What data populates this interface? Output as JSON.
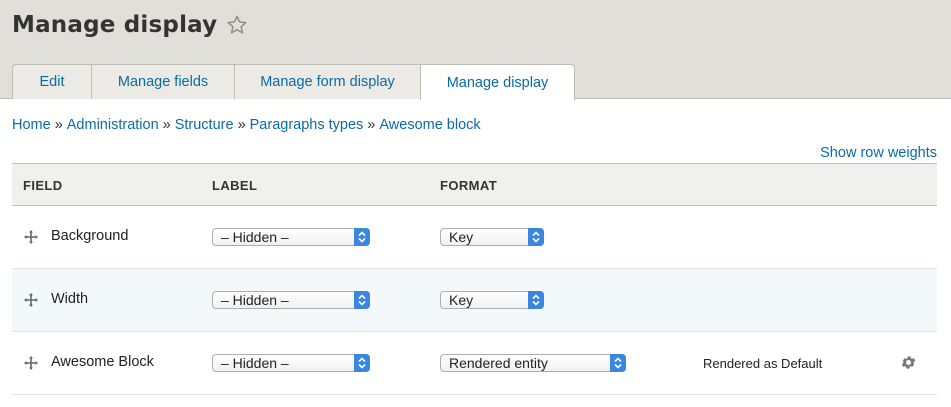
{
  "page": {
    "title": "Manage display"
  },
  "tabs": [
    {
      "label": "Edit"
    },
    {
      "label": "Manage fields"
    },
    {
      "label": "Manage form display"
    },
    {
      "label": "Manage display",
      "active": true
    }
  ],
  "breadcrumb": [
    "Home",
    "Administration",
    "Structure",
    "Paragraphs types",
    "Awesome block"
  ],
  "breadcrumb_separator": "»",
  "row_weights_link": "Show row weights",
  "table": {
    "headers": {
      "field": "FIELD",
      "label": "LABEL",
      "format": "FORMAT"
    },
    "rows": [
      {
        "field": "Background",
        "label": "– Hidden –",
        "format": "Key",
        "summary": ""
      },
      {
        "field": "Width",
        "label": "– Hidden –",
        "format": "Key",
        "summary": ""
      },
      {
        "field": "Awesome Block",
        "label": "– Hidden –",
        "format": "Rendered entity",
        "summary": "Rendered as Default"
      }
    ]
  },
  "colors": {
    "link": "#0b6aa8",
    "header_bg": "#e0dfd9",
    "select_accent": "#3b86e0"
  },
  "icons": {
    "star": "star-outline-icon",
    "drag": "drag-handle-icon",
    "settings": "gear-icon",
    "select": "select-arrows-icon"
  }
}
